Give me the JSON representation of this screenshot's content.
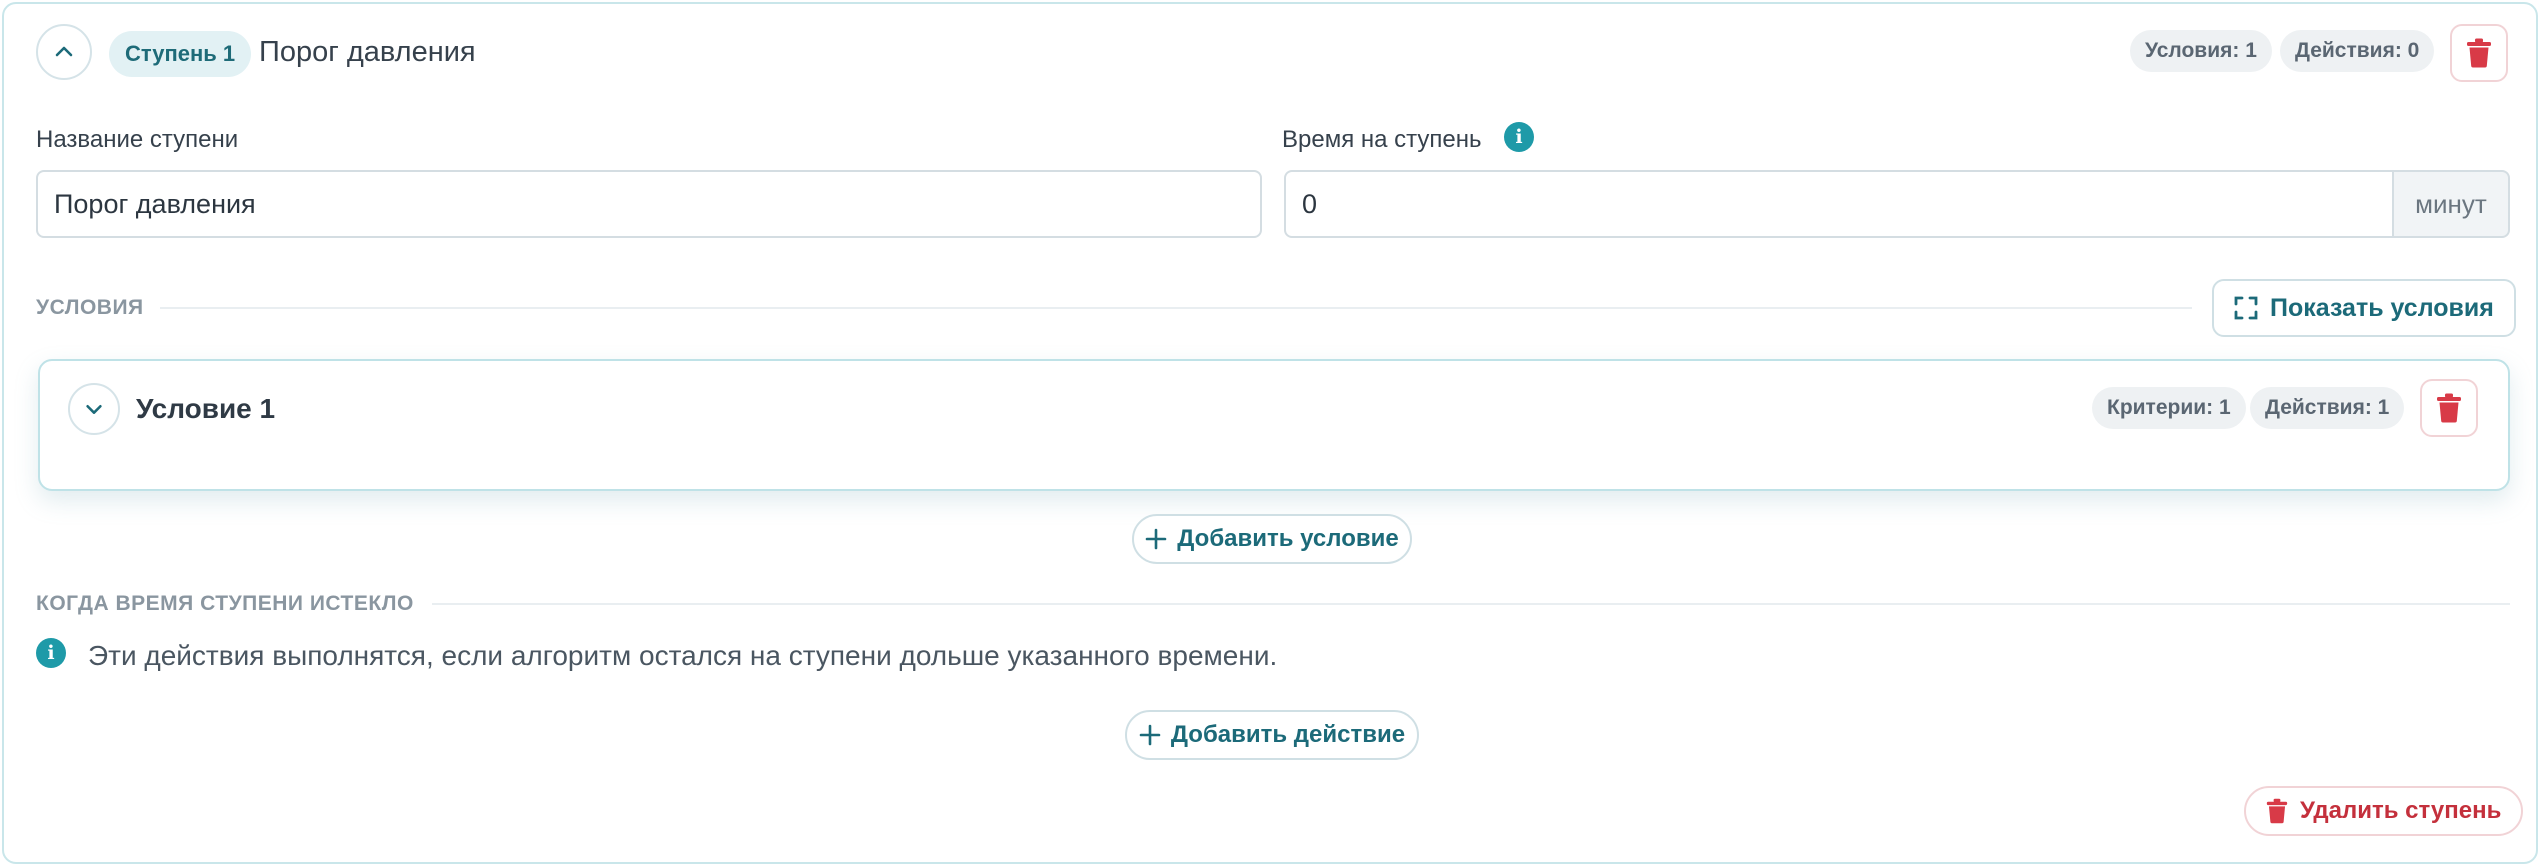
{
  "step": {
    "badge": "Ступень 1",
    "title": "Порог давления",
    "pills": {
      "conditions": "Условия: 1",
      "actions": "Действия: 0"
    },
    "icons": {
      "toggle": "chevron-up-icon",
      "delete": "trash-icon"
    }
  },
  "fields": {
    "name": {
      "label": "Название ступени",
      "value": "Порог давления"
    },
    "time": {
      "label": "Время на ступень",
      "value": "0",
      "unit": "минут",
      "info_icon": "info-icon"
    }
  },
  "conditions_section": {
    "title": "УСЛОВИЯ",
    "show_button": "Показать условия",
    "show_icon": "expand-icon",
    "items": [
      {
        "title": "Условие 1",
        "criteria": "Критерии: 1",
        "actions": "Действия: 1",
        "toggle_icon": "chevron-down-icon"
      }
    ],
    "add_button": "Добавить условие"
  },
  "timeout_section": {
    "title": "КОГДА ВРЕМЯ СТУПЕНИ ИСТЕКЛО",
    "note": "Эти действия выполнятся, если алгоритм остался на ступени дольше указанного времени.",
    "add_button": "Добавить действие"
  },
  "delete_step_button": "Удалить ступень",
  "colors": {
    "accent": "#1c6a79",
    "info": "#1e9aa8",
    "danger": "#d83a47",
    "border": "#c9e6ea"
  }
}
